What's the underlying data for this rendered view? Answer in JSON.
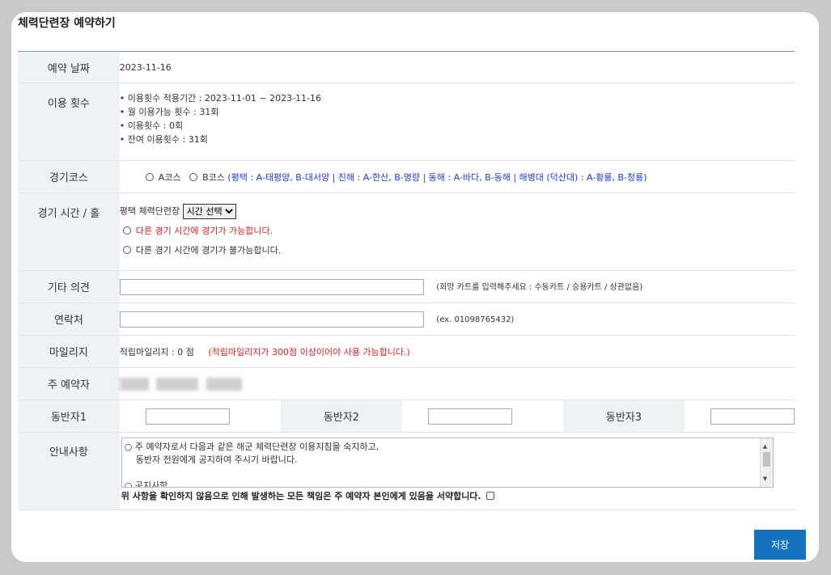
{
  "title": "체력단련장 예약하기",
  "rows": {
    "date": {
      "label": "예약 날짜",
      "value": "2023-11-16"
    },
    "usage": {
      "label": "이용 횟수",
      "lines": [
        "• 이용횟수 적용기간 : 2023-11-01 ~ 2023-11-16",
        "• 월 이용가능 횟수 : 31회",
        "• 이용횟수 : 0회",
        "• 잔여 이용횟수 : 31회"
      ]
    },
    "course": {
      "label": "경기코스",
      "option_a": "A코스",
      "option_b": "B코스",
      "info": "(평택 : A-태평양, B-대서양 | 진해 : A-한산, B-명량 | 동해 : A-바다, B-동해 | 해병대 (덕산대) : A-황룡, B-청룡)"
    },
    "time": {
      "label": "경기 시간 / 홀",
      "venue": "평택 체력단련장",
      "select_value": "시간 선택",
      "option_yes": "다른 경기 시간에 경기가 가능합니다.",
      "option_no": "다른 경기 시간에 경기가 불가능합니다."
    },
    "other": {
      "label": "기타 의견",
      "value": "",
      "note": "(희망 카트를 입력해주세요 : 수동카트 / 승용카트 / 상관없음)"
    },
    "contact": {
      "label": "연락처",
      "value": "",
      "note": "(ex. 01098765432)"
    },
    "mileage": {
      "label": "마일리지",
      "value": "적립마일리지 : 0 점",
      "note": "(적립마일리지가 300점 이상이어야 사용 가능합니다.)"
    },
    "reserver": {
      "label": "주 예약자"
    },
    "companions": {
      "label1": "동반자1",
      "label2": "동반자2",
      "label3": "동반자3",
      "value1": "",
      "value2": "",
      "value3": ""
    },
    "notice": {
      "label": "안내사항",
      "line1": "○ 주 예약자로서 다음과 같은 해군 체력단련장 이용지침을 숙지하고,",
      "line2": "동반자 전원에게 공지하여 주시기 바랍니다.",
      "line3": "○ 공지사항",
      "agree": "위 사항을 확인하지 않음으로 인해 발생하는 모든 책임은 주 예약자 본인에게 있음을 서약합니다."
    }
  },
  "save_label": "저장"
}
